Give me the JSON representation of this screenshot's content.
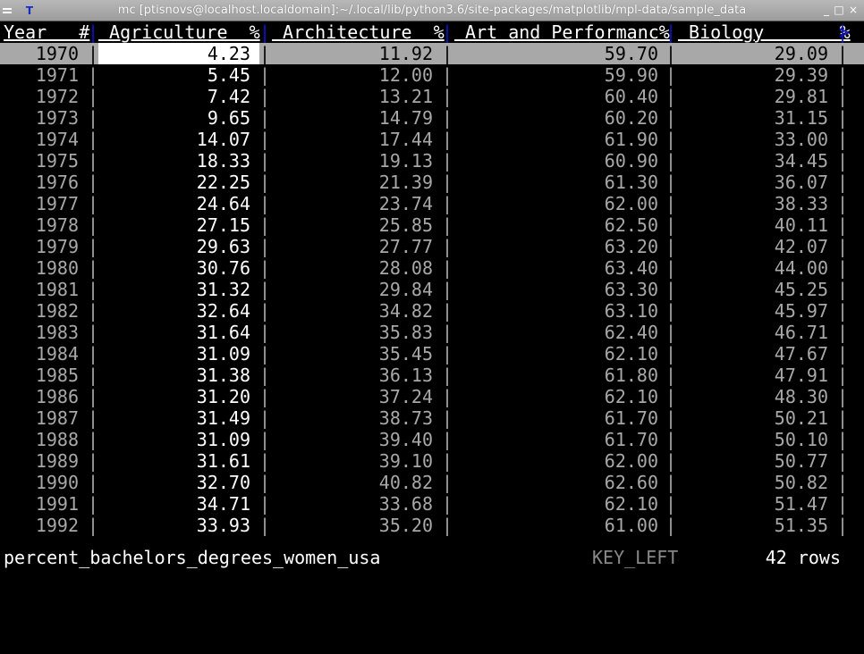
{
  "window": {
    "title": "mc [ptisnovs@localhost.localdomain]:~/.local/lib/python3.6/site-packages/matplotlib/mpl-data/sample_data",
    "app_icon": "T",
    "min_label": "_",
    "max_label": "□",
    "close_label": "×"
  },
  "table": {
    "columns": [
      {
        "key": "year",
        "label": "Year   #"
      },
      {
        "key": "agriculture",
        "label": " Agriculture  %"
      },
      {
        "key": "architecture",
        "label": " Architecture  %"
      },
      {
        "key": "art",
        "label": " Art and Performanc%"
      },
      {
        "key": "biology",
        "label": " Biology       %"
      }
    ],
    "separator": "|",
    "more_columns_indicator": ">",
    "selected_row_index": 0,
    "rows": [
      [
        "1970",
        "4.23",
        "11.92",
        "59.70",
        "29.09"
      ],
      [
        "1971",
        "5.45",
        "12.00",
        "59.90",
        "29.39"
      ],
      [
        "1972",
        "7.42",
        "13.21",
        "60.40",
        "29.81"
      ],
      [
        "1973",
        "9.65",
        "14.79",
        "60.20",
        "31.15"
      ],
      [
        "1974",
        "14.07",
        "17.44",
        "61.90",
        "33.00"
      ],
      [
        "1975",
        "18.33",
        "19.13",
        "60.90",
        "34.45"
      ],
      [
        "1976",
        "22.25",
        "21.39",
        "61.30",
        "36.07"
      ],
      [
        "1977",
        "24.64",
        "23.74",
        "62.00",
        "38.33"
      ],
      [
        "1978",
        "27.15",
        "25.85",
        "62.50",
        "40.11"
      ],
      [
        "1979",
        "29.63",
        "27.77",
        "63.20",
        "42.07"
      ],
      [
        "1980",
        "30.76",
        "28.08",
        "63.40",
        "44.00"
      ],
      [
        "1981",
        "31.32",
        "29.84",
        "63.30",
        "45.25"
      ],
      [
        "1982",
        "32.64",
        "34.82",
        "63.10",
        "45.97"
      ],
      [
        "1983",
        "31.64",
        "35.83",
        "62.40",
        "46.71"
      ],
      [
        "1984",
        "31.09",
        "35.45",
        "62.10",
        "47.67"
      ],
      [
        "1985",
        "31.38",
        "36.13",
        "61.80",
        "47.91"
      ],
      [
        "1986",
        "31.20",
        "37.24",
        "62.10",
        "48.30"
      ],
      [
        "1987",
        "31.49",
        "38.73",
        "61.70",
        "50.21"
      ],
      [
        "1988",
        "31.09",
        "39.40",
        "61.70",
        "50.10"
      ],
      [
        "1989",
        "31.61",
        "39.10",
        "62.00",
        "50.77"
      ],
      [
        "1990",
        "32.70",
        "40.82",
        "62.60",
        "50.82"
      ],
      [
        "1991",
        "34.71",
        "33.68",
        "62.10",
        "51.47"
      ],
      [
        "1992",
        "33.93",
        "35.20",
        "61.00",
        "51.35"
      ]
    ]
  },
  "status": {
    "sheet_name": "percent_bachelors_degrees_women_usa",
    "last_key": "KEY_LEFT",
    "row_count": "42 rows"
  }
}
